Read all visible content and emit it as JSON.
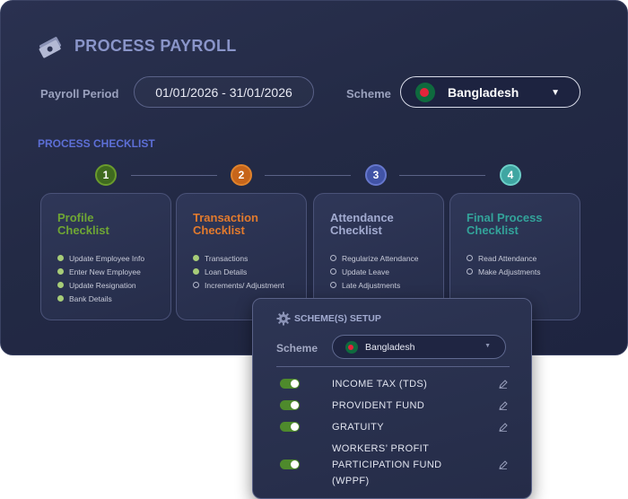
{
  "header": {
    "title": "PROCESS PAYROLL"
  },
  "payroll_period": {
    "label": "Payroll Period",
    "value": "01/01/2026 - 31/01/2026"
  },
  "scheme": {
    "label": "Scheme",
    "value": "Bangladesh",
    "icon": "bangladesh-flag-icon"
  },
  "checklist": {
    "title": "PROCESS CHECKLIST",
    "steps": [
      {
        "number": "1",
        "title": "Profile Checklist",
        "color": "#6fa634",
        "items": [
          {
            "label": "Update Employee Info",
            "done": true
          },
          {
            "label": "Enter New Employee",
            "done": true
          },
          {
            "label": "Update Resignation",
            "done": true
          },
          {
            "label": "Bank Details",
            "done": true
          }
        ]
      },
      {
        "number": "2",
        "title": "Transaction Checklist",
        "color": "#e27a2d",
        "items": [
          {
            "label": "Transactions",
            "done": true
          },
          {
            "label": "Loan Details",
            "done": true
          },
          {
            "label": "Increments/ Adjustment",
            "done": false
          }
        ]
      },
      {
        "number": "3",
        "title": "Attendance Checklist",
        "color": "#a2abd0",
        "items": [
          {
            "label": "Regularize Attendance",
            "done": false
          },
          {
            "label": "Update Leave",
            "done": false
          },
          {
            "label": "Late Adjustments",
            "done": false
          }
        ]
      },
      {
        "number": "4",
        "title": "Final Process Checklist",
        "color": "#33a39a",
        "items": [
          {
            "label": "Read Attendance",
            "done": false
          },
          {
            "label": "Make Adjustments",
            "done": false
          }
        ]
      }
    ]
  },
  "scheme_setup": {
    "title": "SCHEME(S) SETUP",
    "scheme_label": "Scheme",
    "scheme_value": "Bangladesh",
    "funds": [
      {
        "label": "INCOME TAX (TDS)",
        "enabled": true
      },
      {
        "label": "PROVIDENT FUND",
        "enabled": true
      },
      {
        "label": "GRATUITY",
        "enabled": true
      },
      {
        "label": "WORKERS’ PROFIT PARTICIPATION FUND (WPPF)",
        "enabled": true
      }
    ]
  }
}
